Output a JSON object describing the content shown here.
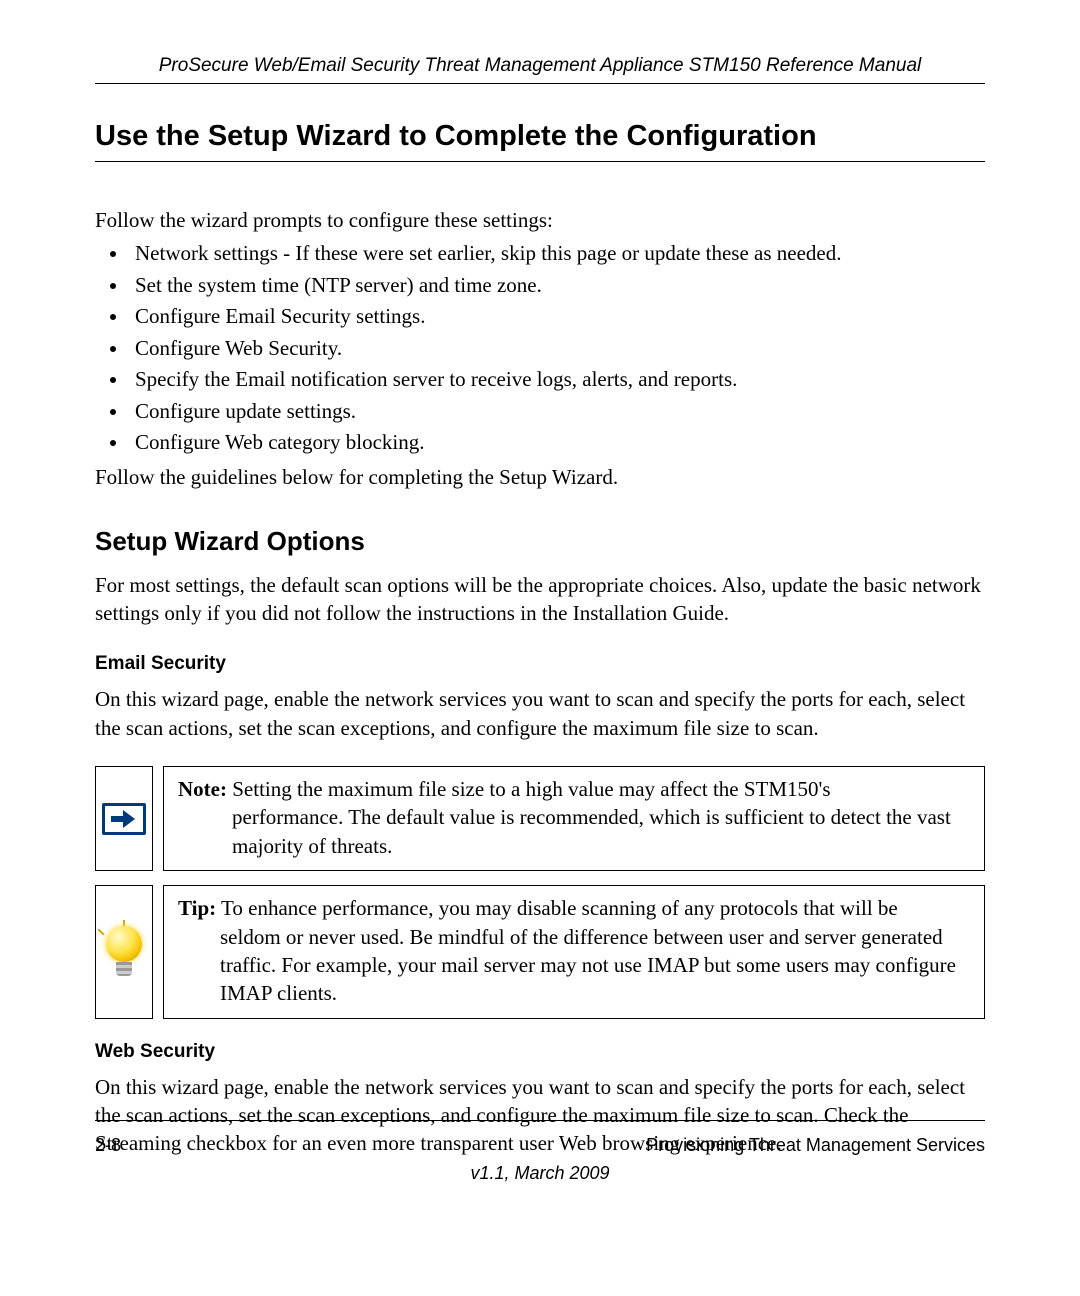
{
  "running_head": "ProSecure Web/Email Security Threat Management Appliance STM150 Reference Manual",
  "h1": "Use the Setup Wizard to Complete the Configuration",
  "lead": "Follow the wizard prompts to configure these settings:",
  "bullets": [
    "Network settings - If these were set earlier, skip this page or update these as needed.",
    "Set the system time (NTP server) and time zone.",
    "Configure Email Security settings.",
    "Configure Web Security.",
    "Specify the Email notification server to receive logs, alerts, and reports.",
    "Configure update settings.",
    "Configure Web category blocking."
  ],
  "after_list": "Follow the guidelines below for completing the Setup Wizard.",
  "h2": "Setup Wizard Options",
  "options_para": "For most settings, the default scan options will be the appropriate choices. Also, update the basic network settings only if you did not follow the instructions in the Installation Guide.",
  "email_h3": "Email Security",
  "email_para": "On this wizard page, enable the network services you want to scan and specify the ports for each, select the scan actions, set the scan exceptions, and configure the maximum file size to scan.",
  "note_label": "Note:",
  "note_first": " Setting the maximum file size to a high value may affect the STM150's",
  "note_rest": "performance. The default value is recommended, which is sufficient to detect the vast majority of threats.",
  "tip_label": "Tip:",
  "tip_first": " To enhance performance, you may disable scanning of any protocols that will be",
  "tip_rest": "seldom or never used. Be mindful of the difference between user and server generated traffic. For example, your mail server may not use IMAP but some users may configure IMAP clients.",
  "web_h3": "Web Security",
  "web_para": "On this wizard page, enable the network services you want to scan and specify the ports for each, select the scan actions, set the scan exceptions, and configure the maximum file size to scan. Check the Streaming checkbox for an even more transparent user Web browsing experience.",
  "footer_left": "2-8",
  "footer_right": "Provisioning Threat Management Services",
  "footer_center": "v1.1, March 2009"
}
